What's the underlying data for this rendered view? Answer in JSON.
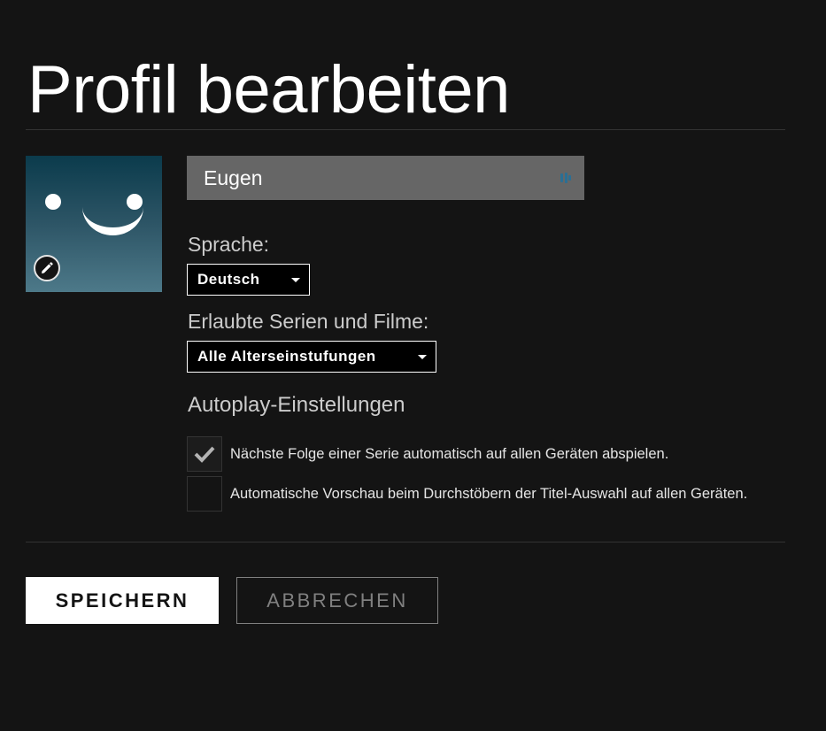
{
  "page": {
    "title": "Profil bearbeiten"
  },
  "profile": {
    "avatar_icon": "smiley-face-avatar",
    "edit_icon": "pencil-icon",
    "name_value": "Eugen",
    "name_field_icon": "password-manager-key-icon"
  },
  "language": {
    "label": "Sprache:",
    "selected": "Deutsch"
  },
  "maturity": {
    "label": "Erlaubte Serien und Filme:",
    "selected": "Alle Alterseinstufungen"
  },
  "autoplay": {
    "heading": "Autoplay-Einstellungen",
    "options": [
      {
        "label": "Nächste Folge einer Serie automatisch auf allen Geräten abspielen.",
        "checked": true
      },
      {
        "label": "Automatische Vorschau beim Durchstöbern der Titel-Auswahl auf allen Geräten.",
        "checked": false
      }
    ]
  },
  "actions": {
    "save_label": "SPEICHERN",
    "cancel_label": "ABBRECHEN"
  },
  "colors": {
    "background": "#141414",
    "name_field": "#666666",
    "divider": "#333333",
    "avatar_top": "#0b3b4c",
    "avatar_bottom": "#4d7989"
  }
}
